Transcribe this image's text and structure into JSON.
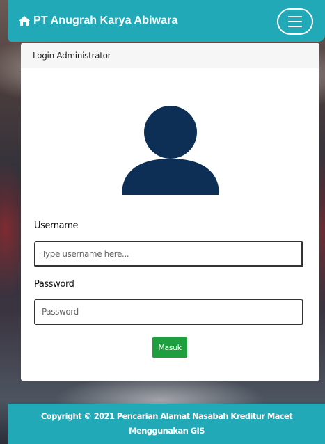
{
  "navbar": {
    "brand_icon": "home-icon",
    "brand_text": "PT Anugrah Karya Abiwara",
    "menu_icon": "hamburger-menu-icon",
    "color": "#21a9b8"
  },
  "login_card": {
    "header": "Login Administrator",
    "avatar_icon": "user-avatar-icon",
    "avatar_color": "#0d2f55",
    "username_label": "Username",
    "username_placeholder": "Type username here...",
    "password_label": "Password",
    "password_placeholder": "Password",
    "submit_label": "Masuk",
    "submit_color": "#1f9e3f"
  },
  "footer": {
    "text": "Copyright © 2021 Pencarian Alamat Nasabah Kreditur Macet Menggunakan GIS"
  }
}
